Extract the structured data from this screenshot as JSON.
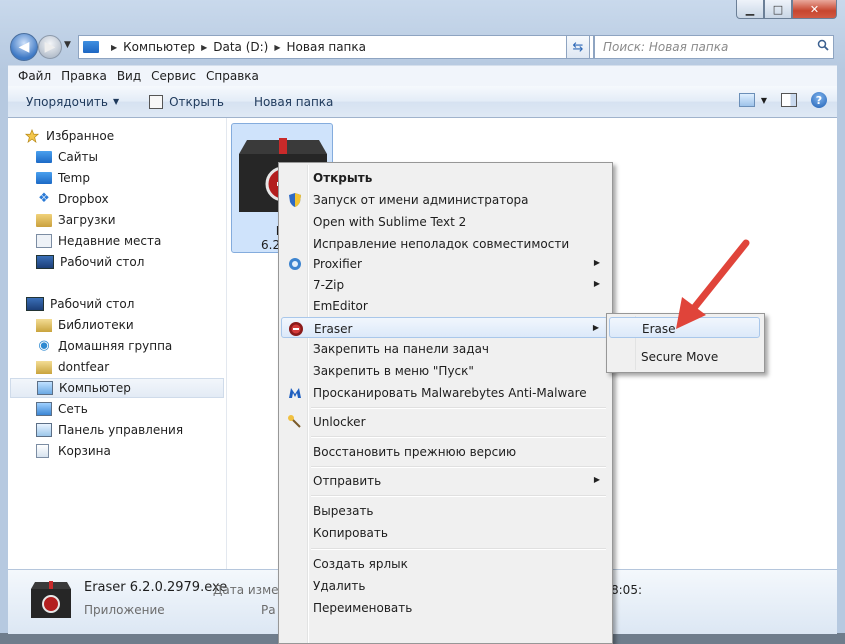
{
  "window": {
    "controls": [
      "minimize",
      "maximize",
      "close"
    ]
  },
  "address": {
    "crumbs": [
      "Компьютер",
      "Data (D:)",
      "Новая папка"
    ],
    "search_placeholder": "Поиск: Новая папка"
  },
  "menubar": [
    "Файл",
    "Правка",
    "Вид",
    "Сервис",
    "Справка"
  ],
  "toolbar": {
    "organize": "Упорядочить",
    "open": "Открыть",
    "new_folder": "Новая папка"
  },
  "nav": {
    "favorites": "Избранное",
    "fav_items": [
      "Сайты",
      "Temp",
      "Dropbox",
      "Загрузки",
      "Недавние места",
      "Рабочий стол"
    ],
    "desktop": "Рабочий стол",
    "desk_items": [
      "Библиотеки",
      "Домашняя группа",
      "dontfear",
      "Компьютер",
      "Сеть",
      "Панель управления",
      "Корзина"
    ]
  },
  "file": {
    "label_line1": "Er",
    "label_line2": "6.2.0.2"
  },
  "details": {
    "name": "Eraser 6.2.0.2979.exe",
    "type": "Приложение",
    "modified_label": "Дата измене",
    "size_label": "Ра",
    "time": "8:05:"
  },
  "context_menu": {
    "items": [
      {
        "label": "Открыть",
        "bold": true
      },
      {
        "label": "Запуск от имени администратора",
        "icon": "shield-icon"
      },
      {
        "label": "Open with Sublime Text 2"
      },
      {
        "label": "Исправление неполадок совместимости"
      },
      {
        "label": "Proxifier",
        "icon": "proxifier-icon",
        "submenu": true
      },
      {
        "label": "7-Zip",
        "submenu": true
      },
      {
        "label": "EmEditor"
      },
      {
        "label": "Eraser",
        "icon": "eraser-icon",
        "submenu": true,
        "highlighted": true
      },
      {
        "label": "Закрепить на панели задач"
      },
      {
        "label": "Закрепить в меню \"Пуск\""
      },
      {
        "label": "Просканировать Malwarebytes Anti-Malware",
        "icon": "malwarebytes-icon"
      },
      {
        "label": "Unlocker",
        "icon": "unlocker-icon"
      },
      {
        "label": "Восстановить прежнюю версию"
      },
      {
        "label": "Отправить",
        "submenu": true
      },
      {
        "label": "Вырезать"
      },
      {
        "label": "Копировать"
      },
      {
        "label": "Создать ярлык"
      },
      {
        "label": "Удалить"
      },
      {
        "label": "Переименовать"
      }
    ]
  },
  "submenu": {
    "items": [
      "Erase",
      "Secure Move"
    ],
    "highlighted": "Erase"
  },
  "colors": {
    "annotation_arrow": "#e0443a",
    "selection": "#cfe3fb"
  }
}
